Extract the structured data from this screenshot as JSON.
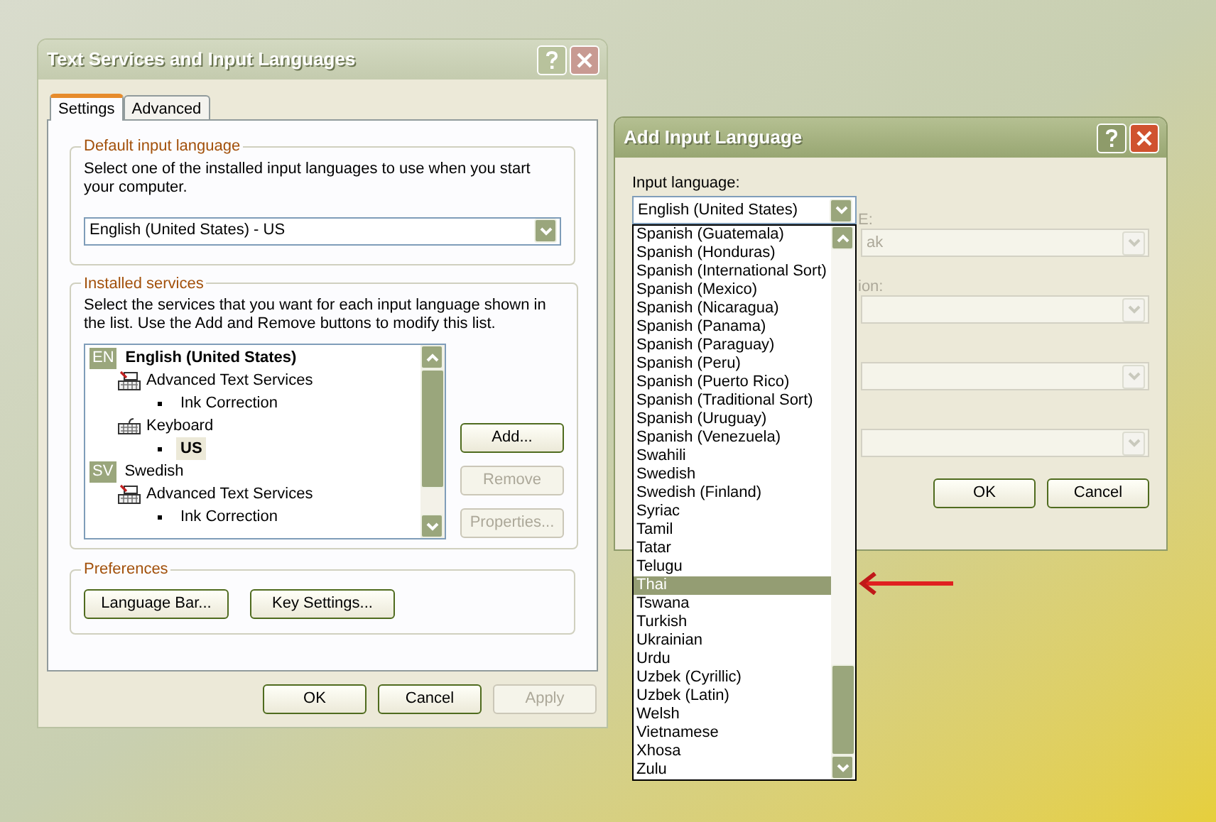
{
  "main_dialog": {
    "title": "Text Services and Input Languages",
    "active": false,
    "tabs": [
      {
        "label": "Settings",
        "selected": true
      },
      {
        "label": "Advanced",
        "selected": false
      }
    ],
    "default_language": {
      "label": "Default input language",
      "description": "Select one of the installed input languages to use when you start your computer.",
      "value": "English (United States) - US"
    },
    "installed_services": {
      "label": "Installed services",
      "description": "Select the services that you want for each input language shown in the list. Use the Add and Remove buttons to modify this list.",
      "tree": [
        {
          "kind": "language",
          "badge": "EN",
          "label": "English (United States)",
          "default": true,
          "children": [
            {
              "kind": "text-services",
              "label": "Advanced Text Services",
              "children": [
                {
                  "kind": "item",
                  "label": "Ink Correction",
                  "selected": false
                }
              ]
            },
            {
              "kind": "keyboard",
              "label": "Keyboard",
              "children": [
                {
                  "kind": "item",
                  "label": "US",
                  "selected": true
                }
              ]
            }
          ]
        },
        {
          "kind": "language",
          "badge": "SV",
          "label": "Swedish",
          "default": false,
          "children": [
            {
              "kind": "text-services",
              "label": "Advanced Text Services",
              "children": [
                {
                  "kind": "item",
                  "label": "Ink Correction",
                  "selected": false
                }
              ]
            }
          ]
        }
      ],
      "buttons": [
        {
          "label": "Add...",
          "disabled": false
        },
        {
          "label": "Remove",
          "disabled": true
        },
        {
          "label": "Properties...",
          "disabled": true
        }
      ]
    },
    "preferences": {
      "label": "Preferences",
      "buttons": [
        {
          "label": "Language Bar...",
          "disabled": false
        },
        {
          "label": "Key Settings...",
          "disabled": false
        }
      ]
    },
    "buttons": [
      {
        "label": "OK",
        "disabled": false
      },
      {
        "label": "Cancel",
        "disabled": false
      },
      {
        "label": "Apply",
        "disabled": true
      }
    ]
  },
  "add_dialog": {
    "title": "Add Input Language",
    "active": true,
    "input_language": {
      "label": "Input language:",
      "value": "English (United States)",
      "options": [
        {
          "label": "Spanish (Guatemala)",
          "selected": false
        },
        {
          "label": "Spanish (Honduras)",
          "selected": false
        },
        {
          "label": "Spanish (International Sort)",
          "selected": false
        },
        {
          "label": "Spanish (Mexico)",
          "selected": false
        },
        {
          "label": "Spanish (Nicaragua)",
          "selected": false
        },
        {
          "label": "Spanish (Panama)",
          "selected": false
        },
        {
          "label": "Spanish (Paraguay)",
          "selected": false
        },
        {
          "label": "Spanish (Peru)",
          "selected": false
        },
        {
          "label": "Spanish (Puerto Rico)",
          "selected": false
        },
        {
          "label": "Spanish (Traditional Sort)",
          "selected": false
        },
        {
          "label": "Spanish (Uruguay)",
          "selected": false
        },
        {
          "label": "Spanish (Venezuela)",
          "selected": false
        },
        {
          "label": "Swahili",
          "selected": false
        },
        {
          "label": "Swedish",
          "selected": false
        },
        {
          "label": "Swedish (Finland)",
          "selected": false
        },
        {
          "label": "Syriac",
          "selected": false
        },
        {
          "label": "Tamil",
          "selected": false
        },
        {
          "label": "Tatar",
          "selected": false
        },
        {
          "label": "Telugu",
          "selected": false
        },
        {
          "label": "Thai",
          "selected": true
        },
        {
          "label": "Tswana",
          "selected": false
        },
        {
          "label": "Turkish",
          "selected": false
        },
        {
          "label": "Ukrainian",
          "selected": false
        },
        {
          "label": "Urdu",
          "selected": false
        },
        {
          "label": "Uzbek (Cyrillic)",
          "selected": false
        },
        {
          "label": "Uzbek (Latin)",
          "selected": false
        },
        {
          "label": "Welsh",
          "selected": false
        },
        {
          "label": "Vietnamese",
          "selected": false
        },
        {
          "label": "Xhosa",
          "selected": false
        },
        {
          "label": "Zulu",
          "selected": false
        }
      ]
    },
    "fields": [
      {
        "label": "E:",
        "value": "ak",
        "disabled": true
      },
      {
        "label": "ion:",
        "disabled": true
      },
      {
        "disabled": true
      },
      {
        "disabled": true
      }
    ],
    "buttons": [
      {
        "label": "OK",
        "disabled": false
      },
      {
        "label": "Cancel",
        "disabled": false
      }
    ]
  }
}
